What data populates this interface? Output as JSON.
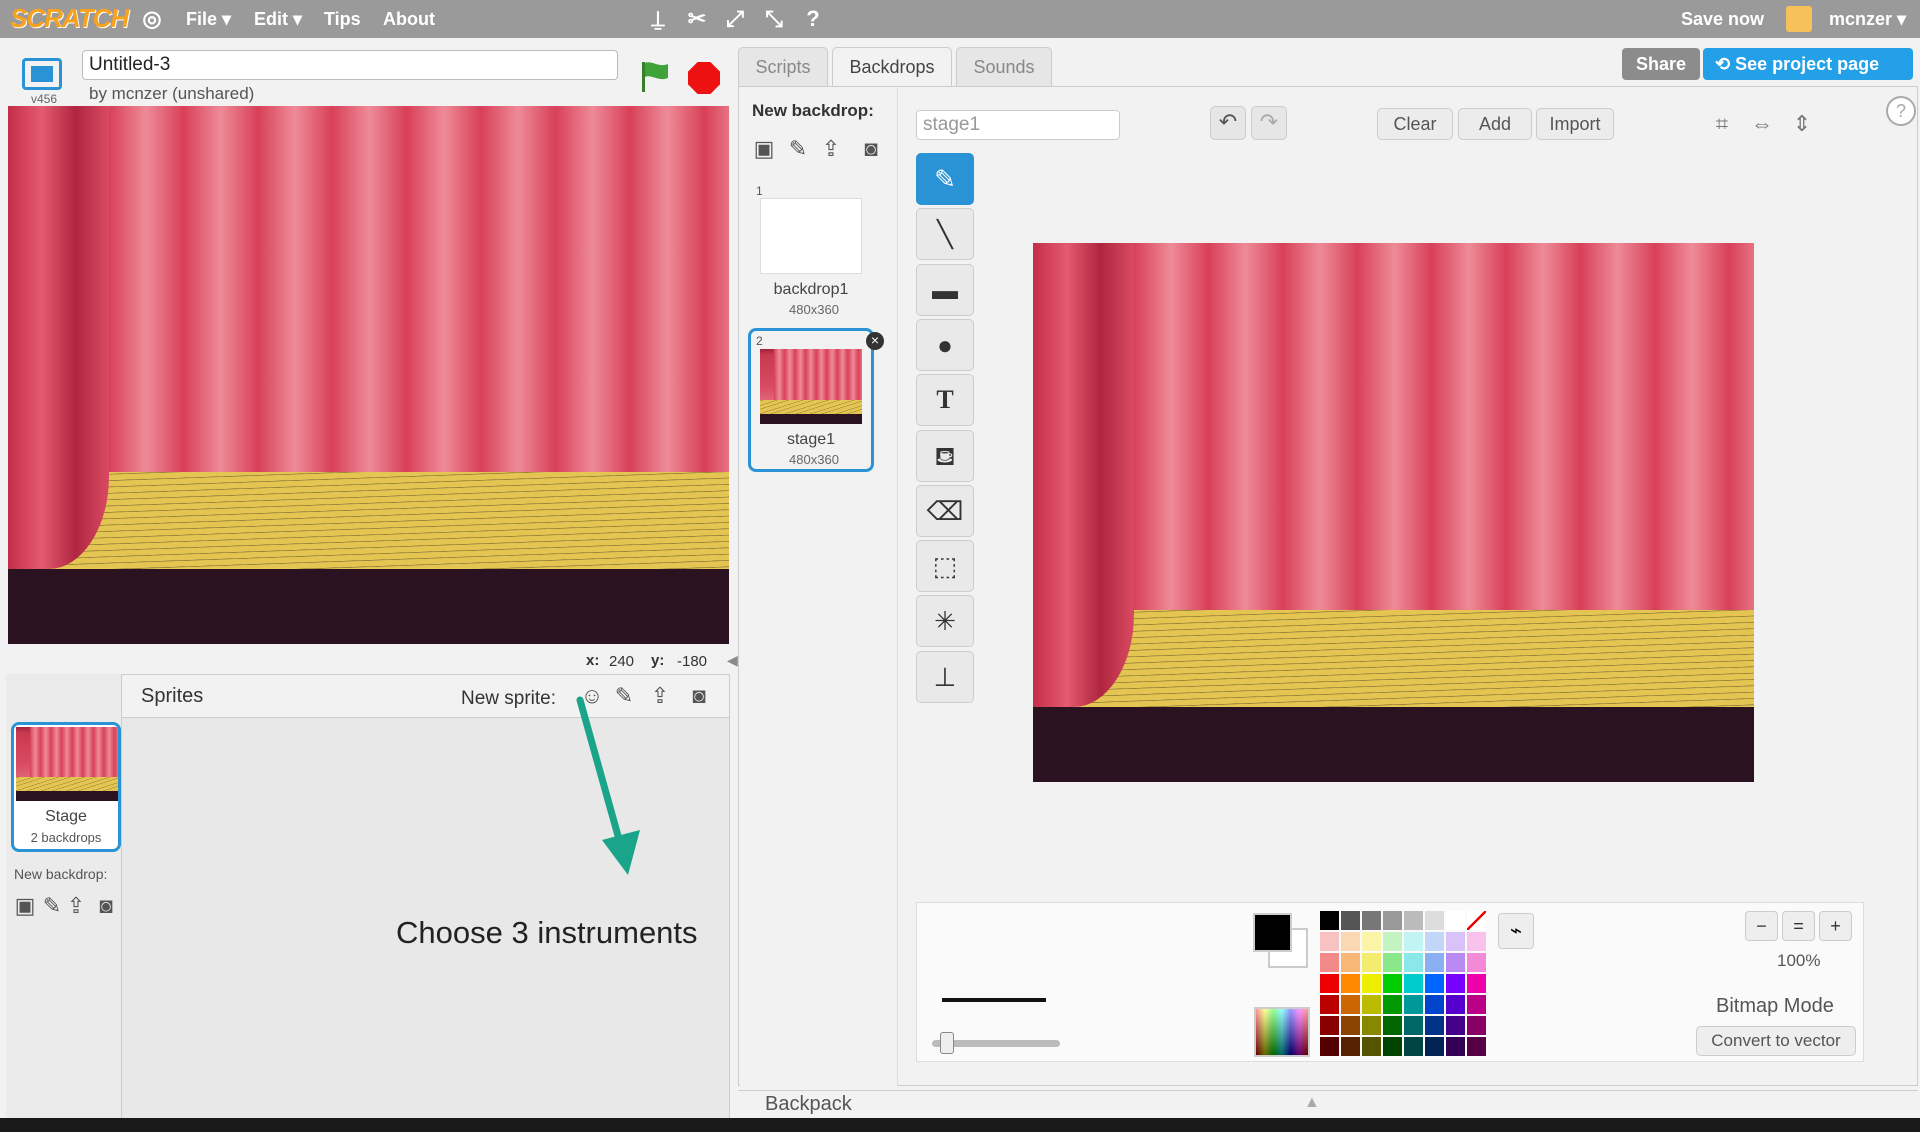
{
  "menubar": {
    "logo": "SCRATCH",
    "file": "File ▾",
    "edit": "Edit ▾",
    "tips": "Tips",
    "about": "About",
    "save_now": "Save now",
    "user": "mcnzer ▾",
    "icons": [
      "globe-icon",
      "duplicate-icon",
      "cut-icon",
      "grow-icon",
      "shrink-icon",
      "help-icon"
    ]
  },
  "project": {
    "title": "Untitled-3",
    "byline": "by mcnzer (unshared)",
    "version": "v456"
  },
  "stage": {
    "x_label": "x:",
    "x_value": "240",
    "y_label": "y:",
    "y_value": "-180"
  },
  "sprites": {
    "title": "Sprites",
    "new_sprite_label": "New sprite:",
    "stage_name": "Stage",
    "stage_count": "2 backdrops",
    "new_backdrop_label": "New backdrop:"
  },
  "annotation": "Choose 3 instruments",
  "tabs": [
    {
      "label": "Scripts"
    },
    {
      "label": "Backdrops"
    },
    {
      "label": "Sounds"
    }
  ],
  "header_buttons": {
    "share": "Share",
    "project_page": "See project page"
  },
  "backdrops": {
    "new_label": "New backdrop:",
    "items": [
      {
        "num": "1",
        "name": "backdrop1",
        "size": "480x360"
      },
      {
        "num": "2",
        "name": "stage1",
        "size": "480x360"
      }
    ]
  },
  "editor": {
    "name_value": "stage1",
    "clear": "Clear",
    "add": "Add",
    "import": "Import",
    "zoom": "100%",
    "mode": "Bitmap Mode",
    "convert": "Convert to vector"
  },
  "backpack": "Backpack",
  "colors": {
    "accent": "#2a93d6",
    "menubar": "#9a9a9a",
    "annotation_arrow": "#1aa58a"
  }
}
